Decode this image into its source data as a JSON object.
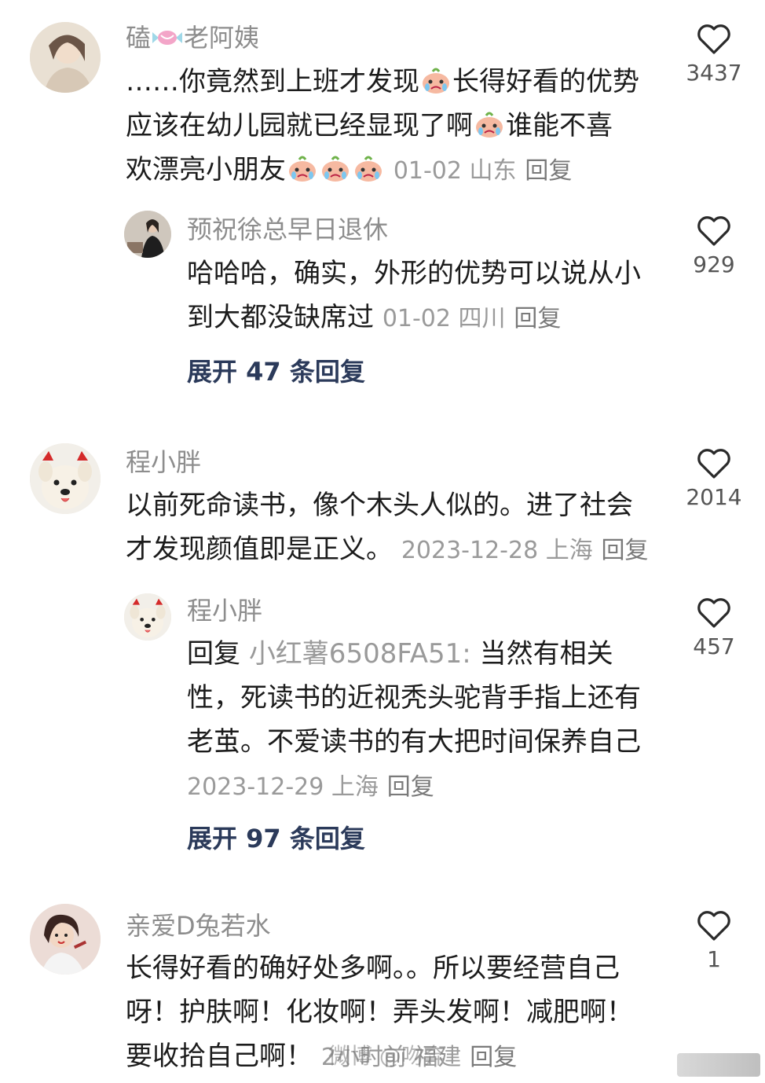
{
  "comments": [
    {
      "name": "磕",
      "name_suffix": "老阿姨",
      "text_parts": [
        "……你竟然到上班才发现",
        "长得好看的优势",
        "应该在幼儿园就已经显现了啊",
        "谁能不喜",
        "欢漂亮小朋友"
      ],
      "meta": "01-02 山东",
      "reply": "回复",
      "likes": "3437",
      "replies": [
        {
          "name": "预祝徐总早日退休",
          "text_line1": "哈哈哈，确实，外形的优势可以说从小",
          "text_line2": "到大都没缺席过",
          "meta": "01-02 四川",
          "reply": "回复",
          "likes": "929"
        }
      ],
      "expand": "展开 47 条回复"
    },
    {
      "name": "程小胖",
      "text_line1": "以前死命读书，像个木头人似的。进了社会",
      "text_line2": "才发现颜值即是正义。",
      "meta": "2023-12-28 上海",
      "reply": "回复",
      "likes": "2014",
      "replies": [
        {
          "name": "程小胖",
          "reply_prefix": "回复",
          "mention": "小红薯6508FA51:",
          "text_line1_rest": "当然有相关",
          "text_line2": "性，死读书的近视秃头驼背手指上还有",
          "text_line3": "老茧。不爱读书的有大把时间保养自己",
          "meta": "2023-12-29 上海",
          "reply": "回复",
          "likes": "457"
        }
      ],
      "expand": "展开 97 条回复"
    },
    {
      "name": "亲爱D兔若水",
      "text_line1": "长得好看的确好处多啊。。所以要经营自己",
      "text_line2": "呀！护肤啊！化妆啊！弄头发啊！减肥啊！",
      "text_line3": "要收拾自己啊！",
      "meta": "2小时前 福建",
      "reply": "回复",
      "likes": "1"
    }
  ],
  "watermark": "微博 @吻奔",
  "icons": [
    "heart-outline-icon",
    "crying-emoji-icon",
    "candy-icon"
  ],
  "colors": {
    "meta": "#9a9a9a",
    "expand": "#2b3a5a",
    "name": "#8d8d8d"
  }
}
